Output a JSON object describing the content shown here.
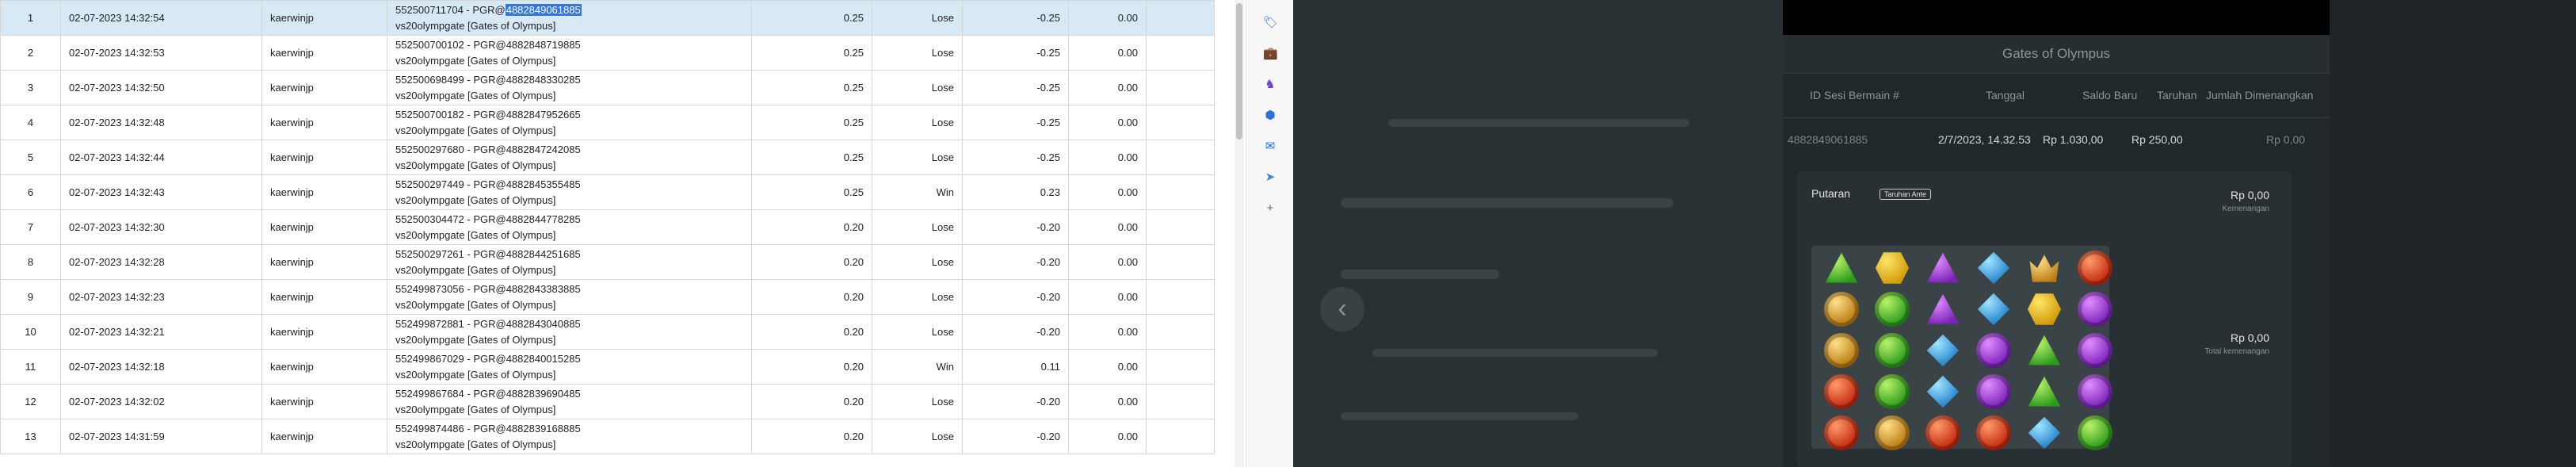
{
  "bets": [
    {
      "no": "1",
      "datetime": "02-07-2023 14:32:54",
      "user": "kaerwinjp",
      "game_prefix": "552500711704 - PGR@",
      "game_id": "4882849061885",
      "game_line2": "vs20olympgate [Gates of Olympus]",
      "bet": "0.25",
      "result": "Lose",
      "winloss": "-0.25",
      "balance": "0.00",
      "selected": true
    },
    {
      "no": "2",
      "datetime": "02-07-2023 14:32:53",
      "user": "kaerwinjp",
      "game_prefix": "552500700102 - PGR@",
      "game_id": "4882848719885",
      "game_line2": "vs20olympgate [Gates of Olympus]",
      "bet": "0.25",
      "result": "Lose",
      "winloss": "-0.25",
      "balance": "0.00"
    },
    {
      "no": "3",
      "datetime": "02-07-2023 14:32:50",
      "user": "kaerwinjp",
      "game_prefix": "552500698499 - PGR@",
      "game_id": "4882848330285",
      "game_line2": "vs20olympgate [Gates of Olympus]",
      "bet": "0.25",
      "result": "Lose",
      "winloss": "-0.25",
      "balance": "0.00"
    },
    {
      "no": "4",
      "datetime": "02-07-2023 14:32:48",
      "user": "kaerwinjp",
      "game_prefix": "552500700182 - PGR@",
      "game_id": "4882847952665",
      "game_line2": "vs20olympgate [Gates of Olympus]",
      "bet": "0.25",
      "result": "Lose",
      "winloss": "-0.25",
      "balance": "0.00"
    },
    {
      "no": "5",
      "datetime": "02-07-2023 14:32:44",
      "user": "kaerwinjp",
      "game_prefix": "552500297680 - PGR@",
      "game_id": "4882847242085",
      "game_line2": "vs20olympgate [Gates of Olympus]",
      "bet": "0.25",
      "result": "Lose",
      "winloss": "-0.25",
      "balance": "0.00"
    },
    {
      "no": "6",
      "datetime": "02-07-2023 14:32:43",
      "user": "kaerwinjp",
      "game_prefix": "552500297449 - PGR@",
      "game_id": "4882845355485",
      "game_line2": "vs20olympgate [Gates of Olympus]",
      "bet": "0.25",
      "result": "Win",
      "winloss": "0.23",
      "balance": "0.00"
    },
    {
      "no": "7",
      "datetime": "02-07-2023 14:32:30",
      "user": "kaerwinjp",
      "game_prefix": "552500304472 - PGR@",
      "game_id": "4882844778285",
      "game_line2": "vs20olympgate [Gates of Olympus]",
      "bet": "0.20",
      "result": "Lose",
      "winloss": "-0.20",
      "balance": "0.00"
    },
    {
      "no": "8",
      "datetime": "02-07-2023 14:32:28",
      "user": "kaerwinjp",
      "game_prefix": "552500297261 - PGR@",
      "game_id": "4882844251685",
      "game_line2": "vs20olympgate [Gates of Olympus]",
      "bet": "0.20",
      "result": "Lose",
      "winloss": "-0.20",
      "balance": "0.00"
    },
    {
      "no": "9",
      "datetime": "02-07-2023 14:32:23",
      "user": "kaerwinjp",
      "game_prefix": "552499873056 - PGR@",
      "game_id": "4882843383885",
      "game_line2": "vs20olympgate [Gates of Olympus]",
      "bet": "0.20",
      "result": "Lose",
      "winloss": "-0.20",
      "balance": "0.00"
    },
    {
      "no": "10",
      "datetime": "02-07-2023 14:32:21",
      "user": "kaerwinjp",
      "game_prefix": "552499872881 - PGR@",
      "game_id": "4882843040885",
      "game_line2": "vs20olympgate [Gates of Olympus]",
      "bet": "0.20",
      "result": "Lose",
      "winloss": "-0.20",
      "balance": "0.00"
    },
    {
      "no": "11",
      "datetime": "02-07-2023 14:32:18",
      "user": "kaerwinjp",
      "game_prefix": "552499867029 - PGR@",
      "game_id": "4882840015285",
      "game_line2": "vs20olympgate [Gates of Olympus]",
      "bet": "0.20",
      "result": "Win",
      "winloss": "0.11",
      "balance": "0.00"
    },
    {
      "no": "12",
      "datetime": "02-07-2023 14:32:02",
      "user": "kaerwinjp",
      "game_prefix": "552499867684 - PGR@",
      "game_id": "4882839690485",
      "game_line2": "vs20olympgate [Gates of Olympus]",
      "bet": "0.20",
      "result": "Lose",
      "winloss": "-0.20",
      "balance": "0.00"
    },
    {
      "no": "13",
      "datetime": "02-07-2023 14:31:59",
      "user": "kaerwinjp",
      "game_prefix": "552499874486 - PGR@",
      "game_id": "4882839168885",
      "game_line2": "vs20olympgate [Gates of Olympus]",
      "bet": "0.20",
      "result": "Lose",
      "winloss": "-0.20",
      "balance": "0.00"
    }
  ],
  "extensions": [
    {
      "icon": "tag-icon",
      "glyph": "🏷",
      "color": "#2f6fdc"
    },
    {
      "icon": "briefcase-icon",
      "glyph": "💼",
      "color": "#d9612a"
    },
    {
      "icon": "chess-icon",
      "glyph": "♞",
      "color": "#6a3fc9"
    },
    {
      "icon": "office-icon",
      "glyph": "⬢",
      "color": "#2f6fdc"
    },
    {
      "icon": "outlook-icon",
      "glyph": "✉",
      "color": "#1a73e8"
    },
    {
      "icon": "send-icon",
      "glyph": "➤",
      "color": "#3a86d8"
    },
    {
      "icon": "plus-icon",
      "glyph": "+",
      "color": "#666666"
    }
  ],
  "game": {
    "title": "Gates of Olympus",
    "headers": [
      "ID Sesi Bermain #",
      "Tanggal",
      "Saldo Baru",
      "Taruhan",
      "Jumlah Dimenangkan"
    ],
    "row": [
      "4882849061885",
      "2/7/2023, 14.32.53",
      "Rp 1.030,00",
      "Rp 250,00",
      "Rp 0,00"
    ],
    "putaran": "Putaran",
    "ante": "Taruhan Ante",
    "win_amount": "Rp 0,00",
    "win_label": "Kemenangan",
    "total_amount": "Rp 0,00",
    "total_label": "Total kemenangan",
    "colors": {
      "bg": "#1f2527",
      "panel": "#283033",
      "grid": "#3a4346"
    },
    "symbols": [
      "green-triangle",
      "yellow-hex",
      "purple-triangle",
      "blue-diamond",
      "gold-crown",
      "red-ring",
      "gold-ring",
      "green-ring",
      "purple-triangle",
      "blue-diamond",
      "yellow-hex",
      "purple-ring",
      "gold-ring",
      "green-ring",
      "blue-diamond",
      "purple-ring",
      "green-triangle",
      "purple-ring",
      "red-ring",
      "green-ring",
      "blue-diamond",
      "purple-ring",
      "green-triangle",
      "purple-ring",
      "red-ring",
      "gold-ring",
      "red-ring",
      "red-ring",
      "blue-diamond",
      "green-ring"
    ]
  }
}
